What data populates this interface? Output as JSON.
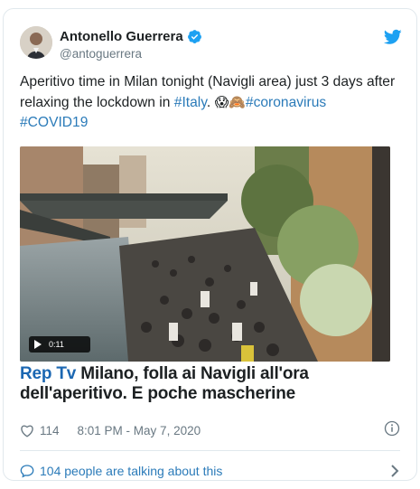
{
  "author": {
    "display_name": "Antonello Guerrera",
    "handle": "@antoguerrera",
    "verified": true
  },
  "tweet": {
    "text_before": "Aperitivo time in Milan tonight (Navigli area) just 3 days after relaxing the lockdown in ",
    "link_italy": "#Italy",
    "text_after": ". ",
    "emojis": "😱🙈",
    "hashtag_coronavirus": "#coronavirus",
    "hashtag_covid": "#COVID19"
  },
  "media": {
    "type": "video",
    "duration": "0:11",
    "headline_brand": "Rep Tv",
    "headline_text": " Milano, folla ai Navigli all'ora dell'aperitivo. E poche mascherine"
  },
  "footer": {
    "like_count": "114",
    "timestamp": "8:01 PM - May 7, 2020",
    "talking_text": "104 people are talking about this"
  },
  "colors": {
    "link": "#2b7bb9",
    "brand_blue": "#1b67b2",
    "muted": "#697882",
    "twitter_blue": "#1da1f2"
  },
  "icons": [
    "verified-badge-icon",
    "twitter-bird-icon",
    "heart-icon",
    "info-icon",
    "speech-bubble-icon",
    "chevron-right-icon",
    "play-icon"
  ]
}
